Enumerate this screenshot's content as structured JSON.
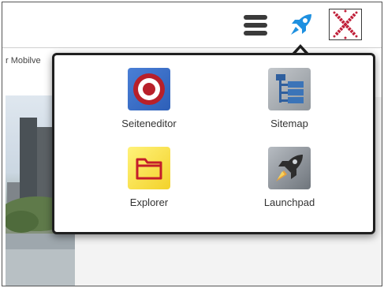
{
  "header": {
    "menu_icon": "hamburger-icon",
    "launch_icon": "rocket-icon",
    "close_icon": "close-x-icon",
    "accent": "#1e90e0",
    "close_color": "#c0203a"
  },
  "background": {
    "breadcrumb_fragment": "r Mobilve"
  },
  "launcher": {
    "items": [
      {
        "label": "Seiteneditor",
        "icon": "target-roundel-icon"
      },
      {
        "label": "Sitemap",
        "icon": "sitemap-tree-icon"
      },
      {
        "label": "Explorer",
        "icon": "folder-icon"
      },
      {
        "label": "Launchpad",
        "icon": "rocket-icon"
      }
    ]
  }
}
